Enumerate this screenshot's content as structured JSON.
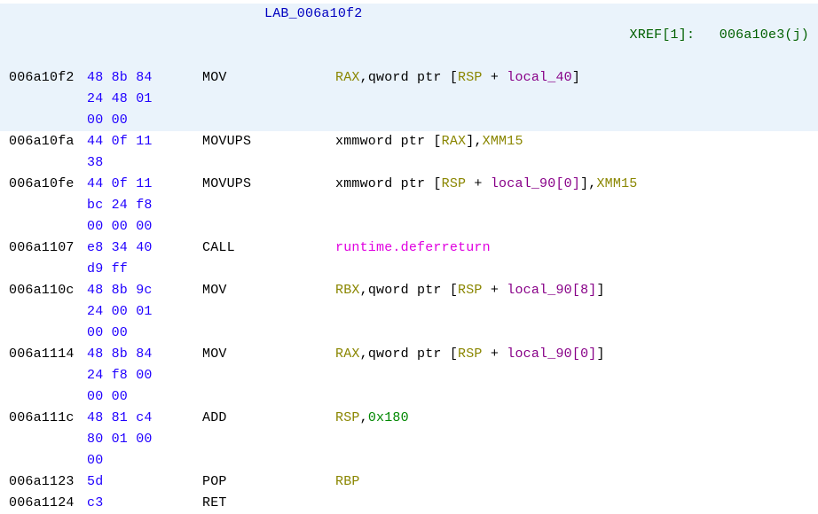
{
  "label_line": {
    "name": "LAB_006a10f2",
    "xref_label": "XREF[1]:",
    "xref_addr": "006a10e3(j)"
  },
  "rows": [
    {
      "addr": "006a10f2",
      "byte_lines": [
        "48 8b 84",
        "24 48 01",
        "00 00"
      ],
      "mnem": "MOV",
      "ops": [
        {
          "t": "reg",
          "v": "RAX"
        },
        {
          "t": "comma",
          "v": ","
        },
        {
          "t": "kw",
          "v": "qword ptr "
        },
        {
          "t": "kw",
          "v": "["
        },
        {
          "t": "reg",
          "v": "RSP"
        },
        {
          "t": "kw",
          "v": " + "
        },
        {
          "t": "var",
          "v": "local_40"
        },
        {
          "t": "kw",
          "v": "]"
        }
      ],
      "hl": true
    },
    {
      "addr": "006a10fa",
      "byte_lines": [
        "44 0f 11",
        "38"
      ],
      "mnem": "MOVUPS",
      "ops": [
        {
          "t": "kw",
          "v": "xmmword ptr "
        },
        {
          "t": "kw",
          "v": "["
        },
        {
          "t": "reg",
          "v": "RAX"
        },
        {
          "t": "kw",
          "v": "]"
        },
        {
          "t": "comma",
          "v": ","
        },
        {
          "t": "reg",
          "v": "XMM15"
        }
      ],
      "hl": false
    },
    {
      "addr": "006a10fe",
      "byte_lines": [
        "44 0f 11",
        "bc 24 f8",
        "00 00 00"
      ],
      "mnem": "MOVUPS",
      "ops": [
        {
          "t": "kw",
          "v": "xmmword ptr "
        },
        {
          "t": "kw",
          "v": "["
        },
        {
          "t": "reg",
          "v": "RSP"
        },
        {
          "t": "kw",
          "v": " + "
        },
        {
          "t": "var",
          "v": "local_90[0]"
        },
        {
          "t": "kw",
          "v": "]"
        },
        {
          "t": "comma",
          "v": ","
        },
        {
          "t": "reg",
          "v": "XMM15"
        }
      ],
      "hl": false
    },
    {
      "addr": "006a1107",
      "byte_lines": [
        "e8 34 40",
        "d9 ff"
      ],
      "mnem": "CALL",
      "ops": [
        {
          "t": "call",
          "v": "runtime.deferreturn"
        }
      ],
      "hl": false
    },
    {
      "addr": "006a110c",
      "byte_lines": [
        "48 8b 9c",
        "24 00 01",
        "00 00"
      ],
      "mnem": "MOV",
      "ops": [
        {
          "t": "reg",
          "v": "RBX"
        },
        {
          "t": "comma",
          "v": ","
        },
        {
          "t": "kw",
          "v": "qword ptr "
        },
        {
          "t": "kw",
          "v": "["
        },
        {
          "t": "reg",
          "v": "RSP"
        },
        {
          "t": "kw",
          "v": " + "
        },
        {
          "t": "var",
          "v": "local_90[8]"
        },
        {
          "t": "kw",
          "v": "]"
        }
      ],
      "hl": false
    },
    {
      "addr": "006a1114",
      "byte_lines": [
        "48 8b 84",
        "24 f8 00",
        "00 00"
      ],
      "mnem": "MOV",
      "ops": [
        {
          "t": "reg",
          "v": "RAX"
        },
        {
          "t": "comma",
          "v": ","
        },
        {
          "t": "kw",
          "v": "qword ptr "
        },
        {
          "t": "kw",
          "v": "["
        },
        {
          "t": "reg",
          "v": "RSP"
        },
        {
          "t": "kw",
          "v": " + "
        },
        {
          "t": "var",
          "v": "local_90[0]"
        },
        {
          "t": "kw",
          "v": "]"
        }
      ],
      "hl": false
    },
    {
      "addr": "006a111c",
      "byte_lines": [
        "48 81 c4",
        "80 01 00",
        "00"
      ],
      "mnem": "ADD",
      "ops": [
        {
          "t": "reg",
          "v": "RSP"
        },
        {
          "t": "comma",
          "v": ","
        },
        {
          "t": "imm",
          "v": "0x180"
        }
      ],
      "hl": false
    },
    {
      "addr": "006a1123",
      "byte_lines": [
        "5d"
      ],
      "mnem": "POP",
      "ops": [
        {
          "t": "reg",
          "v": "RBP"
        }
      ],
      "hl": false
    },
    {
      "addr": "006a1124",
      "byte_lines": [
        "c3"
      ],
      "mnem": "RET",
      "ops": [],
      "hl": false
    }
  ]
}
